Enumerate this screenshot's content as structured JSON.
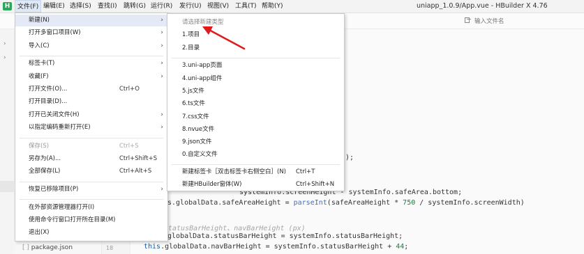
{
  "app": {
    "logo": "H",
    "window_title": "uniapp_1.0.9/App.vue - HBuilder X 4.76"
  },
  "menubar": {
    "items": [
      "文件(F)",
      "编辑(E)",
      "选择(S)",
      "查找(I)",
      "跳转(G)",
      "运行(R)",
      "发行(U)",
      "视图(V)",
      "工具(T)",
      "帮助(Y)"
    ]
  },
  "toolbar": {
    "search_placeholder": "输入文件名"
  },
  "file_menu": {
    "items": [
      {
        "label": "新建(N)",
        "shortcut": "",
        "arrow": "›",
        "active": true
      },
      {
        "label": "打开多窗口项目(W)",
        "shortcut": "",
        "arrow": "›"
      },
      {
        "label": "导入(C)",
        "shortcut": "",
        "arrow": "›"
      },
      {
        "label": "标签卡(T)",
        "shortcut": "",
        "arrow": "›"
      },
      {
        "label": "收藏(F)",
        "shortcut": "",
        "arrow": "›"
      },
      {
        "label": "打开文件(O)...",
        "shortcut": "Ctrl+O",
        "arrow": ""
      },
      {
        "label": "打开目录(D)...",
        "shortcut": "",
        "arrow": ""
      },
      {
        "label": "打开已关闭文件(H)",
        "shortcut": "",
        "arrow": "›"
      },
      {
        "label": "以指定编码重新打开(E)",
        "shortcut": "",
        "arrow": "›"
      },
      {
        "label": "保存(S)",
        "shortcut": "Ctrl+S",
        "arrow": "",
        "disabled": true
      },
      {
        "label": "另存为(A)...",
        "shortcut": "Ctrl+Shift+S",
        "arrow": ""
      },
      {
        "label": "全部保存(L)",
        "shortcut": "Ctrl+Alt+S",
        "arrow": ""
      },
      {
        "label": "恢复已移除项目(P)",
        "shortcut": "",
        "arrow": "›"
      },
      {
        "label": "在外部资源管理器打开(I)",
        "shortcut": "",
        "arrow": ""
      },
      {
        "label": "使用命令行窗口打开所在目录(M)",
        "shortcut": "",
        "arrow": ""
      },
      {
        "label": "退出(X)",
        "shortcut": "",
        "arrow": ""
      }
    ]
  },
  "new_submenu": {
    "hint": "请选择新建类型",
    "items": [
      {
        "label": "1.项目",
        "shortcut": ""
      },
      {
        "label": "2.目录",
        "shortcut": ""
      },
      {
        "label": "3.uni-app页面",
        "shortcut": ""
      },
      {
        "label": "4.uni-app组件",
        "shortcut": ""
      },
      {
        "label": "5.js文件",
        "shortcut": ""
      },
      {
        "label": "6.ts文件",
        "shortcut": ""
      },
      {
        "label": "7.css文件",
        "shortcut": ""
      },
      {
        "label": "8.nvue文件",
        "shortcut": ""
      },
      {
        "label": "9.json文件",
        "shortcut": ""
      },
      {
        "label": "0.自定义文件",
        "shortcut": ""
      },
      {
        "label": "新建标签卡［双击标签卡右侧空白］(N)",
        "shortcut": "Ctrl+T"
      },
      {
        "label": "新建HBuilder窗体(W)",
        "shortcut": "Ctrl+Shift+N"
      }
    ]
  },
  "explorer": {
    "file_label": "package.json",
    "line_number": "18"
  },
  "code": {
    "fragment_1": ");",
    "fragment_2": "systemInfo.screenHeight - systemInfo.safeArea.bottom;",
    "line_a_prefix": "s.globalData.safeAreaHeight = ",
    "line_a_fn": "parseInt",
    "line_a_mid": "(safeAreaHeight * ",
    "line_a_num": "750",
    "line_a_suffix": " / systemInfo.screenWidth)",
    "comment": "tatusBarHeight、navBarHeight (px)",
    "line_b": ".globalData.statusBarHeight = systemInfo.statusBarHeight;",
    "line_c_kw": "this",
    "line_c_mid": ".globalData.navBarHeight = systemInfo.statusBarHeight + ",
    "line_c_num": "44",
    "line_c_end": ";"
  },
  "colors": {
    "annotation_arrow": "#e0191b",
    "menu_highlight": "#e3e9f5",
    "logo": "#2aa85a"
  }
}
